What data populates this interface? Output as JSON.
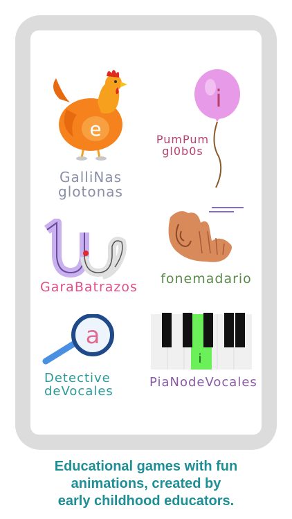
{
  "games": [
    {
      "title_line1": "GalliNas",
      "title_line2": "glotonas",
      "letter": "e",
      "color": "#8a8fa6"
    },
    {
      "title_line1": "PumPum",
      "title_line2": "gl0b0s",
      "letter": "i",
      "color": "#b8406e"
    },
    {
      "title": "GaraBatrazos",
      "color": "#e0508a"
    },
    {
      "title": "fonemadario",
      "color": "#5a8a4a"
    },
    {
      "title_line1": "Detective",
      "title_line2": "deVocales",
      "letter": "a",
      "color": "#2a9a9a"
    },
    {
      "title": "PiaNodeVocales",
      "letter": "i",
      "color": "#8a5aa6"
    }
  ],
  "caption": {
    "line1": "Educational games with fun",
    "line2": "animations, created by",
    "line3": "early childhood educators."
  },
  "colors": {
    "frame": "#dcdcdc",
    "caption": "#1e8f95"
  }
}
